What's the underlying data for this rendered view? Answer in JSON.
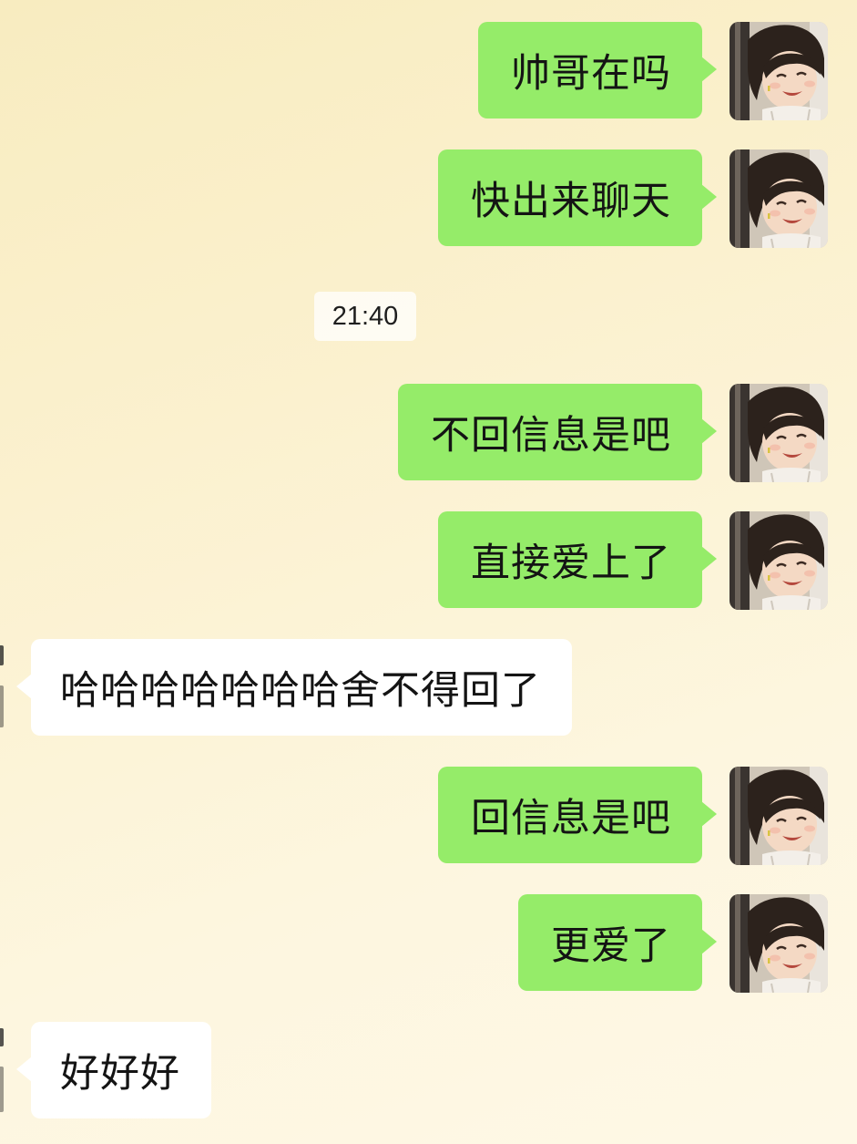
{
  "timestamp": "21:40",
  "avatar_icon": "girl-portrait-avatar",
  "colors": {
    "outgoing_bubble": "#95ec69",
    "incoming_bubble": "#ffffff",
    "background": "#fbf1cf"
  },
  "messages": [
    {
      "direction": "out",
      "text": "帅哥在吗"
    },
    {
      "direction": "out",
      "text": "快出来聊天"
    },
    {
      "direction": "out",
      "text": "不回信息是吧"
    },
    {
      "direction": "out",
      "text": "直接爱上了"
    },
    {
      "direction": "in",
      "text": "哈哈哈哈哈哈哈舍不得回了"
    },
    {
      "direction": "out",
      "text": "回信息是吧"
    },
    {
      "direction": "out",
      "text": "更爱了"
    },
    {
      "direction": "in",
      "text": "好好好"
    }
  ]
}
